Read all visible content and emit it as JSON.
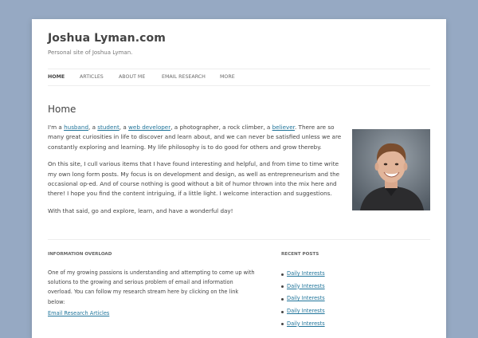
{
  "site": {
    "title": "Joshua Lyman.com",
    "description": "Personal site of Joshua Lyman."
  },
  "nav": {
    "items": [
      {
        "label": "HOME"
      },
      {
        "label": "ARTICLES"
      },
      {
        "label": "ABOUT ME"
      },
      {
        "label": "EMAIL RESEARCH"
      },
      {
        "label": "MORE"
      }
    ]
  },
  "main": {
    "title": "Home",
    "p1": {
      "t1": "I'm a ",
      "link_husband": "husband",
      "t2": ", a ",
      "link_student": "student",
      "t3": ", a ",
      "link_webdev": "web developer",
      "t4": ", a photographer, a rock climber, a ",
      "link_believer": "believer",
      "t5": ". There are so many great curiosities in life to discover and learn about, and we can never be satisfied unless we are constantly exploring and learning. My life philosophy is to do good for others and grow thereby."
    },
    "p2": "On this site, I cull various items that I have found interesting and helpful, and from time to time write my own long form posts. My focus is on development and design, as well as entrepreneurism and the occasional op-ed. And of course nothing is good without a bit of humor thrown into the mix here and there! I hope you find the content intriguing, if a little light. I welcome interaction and suggestions.",
    "p3": "With that said, go and explore, learn, and have a wonderful day!"
  },
  "widgets": {
    "left": {
      "title": "INFORMATION OVERLOAD",
      "text": "One of my growing passions is understanding and attempting to come up with solutions to the growing and serious problem of email and information overload. You can follow my research stream here by clicking on the link below:",
      "link": "Email Research Articles"
    },
    "right": {
      "title": "RECENT POSTS",
      "items": [
        {
          "label": "Daily Interests"
        },
        {
          "label": "Daily Interests"
        },
        {
          "label": "Daily Interests"
        },
        {
          "label": "Daily Interests"
        },
        {
          "label": "Daily Interests"
        }
      ]
    }
  }
}
